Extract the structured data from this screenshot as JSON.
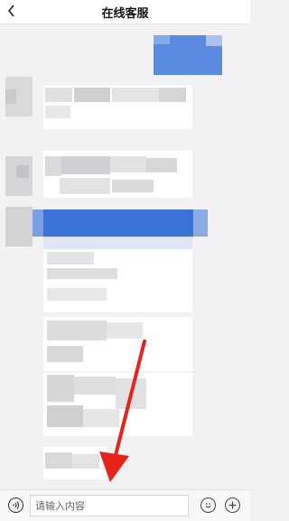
{
  "header": {
    "title": "在线客服"
  },
  "input_bar": {
    "placeholder": "请输入内容"
  },
  "colors": {
    "accent_blue": "#3b73d9",
    "annotation_red": "#e8231a"
  },
  "icons": {
    "back": "chevron-left-icon",
    "voice": "voice-icon",
    "emoji": "smile-icon",
    "plus": "plus-icon"
  }
}
